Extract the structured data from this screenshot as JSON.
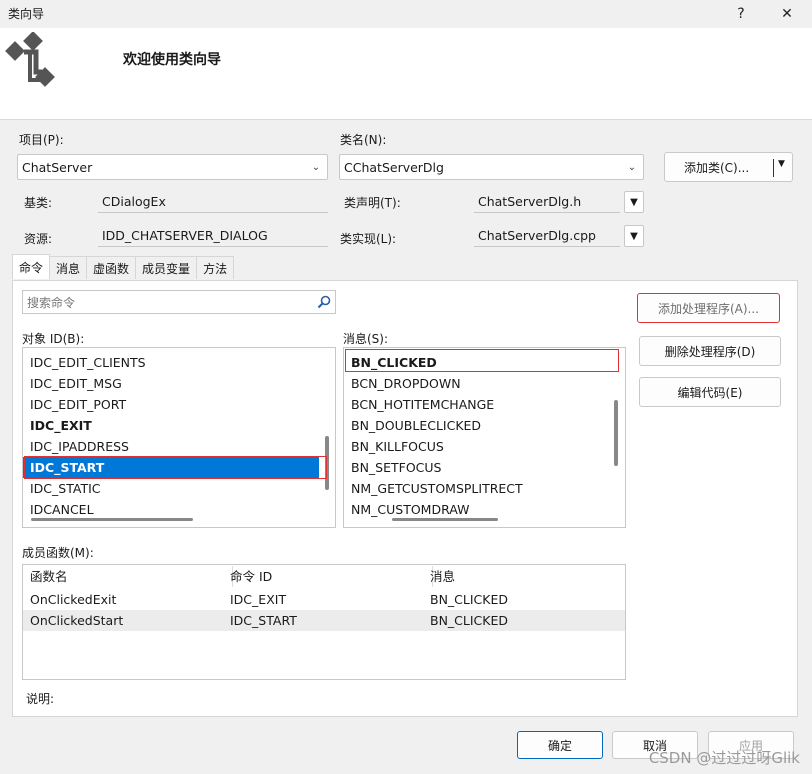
{
  "window": {
    "title": "类向导",
    "help_glyph": "?",
    "close_glyph": "✕"
  },
  "header": {
    "title": "欢迎使用类向导",
    "logo_icon": "class-wizard-logo-icon"
  },
  "project": {
    "label": "项目(P):",
    "value": "ChatServer"
  },
  "classname": {
    "label": "类名(N):",
    "value": "CChatServerDlg"
  },
  "add_class_button": "添加类(C)...",
  "base_class": {
    "label": "基类:",
    "value": "CDialogEx"
  },
  "resource": {
    "label": "资源:",
    "value": "IDD_CHATSERVER_DIALOG"
  },
  "class_decl": {
    "label": "类声明(T):",
    "value": "ChatServerDlg.h"
  },
  "class_impl": {
    "label": "类实现(L):",
    "value": "ChatServerDlg.cpp"
  },
  "tabs": [
    "命令",
    "消息",
    "虚函数",
    "成员变量",
    "方法"
  ],
  "search": {
    "placeholder": "搜索命令",
    "icon": "search-icon"
  },
  "objects": {
    "label": "对象 ID(B):",
    "items": [
      "IDC_EDIT_CLIENTS",
      "IDC_EDIT_MSG",
      "IDC_EDIT_PORT",
      "IDC_EXIT",
      "IDC_IPADDRESS",
      "IDC_START",
      "IDC_STATIC",
      "IDCANCEL"
    ],
    "selected": "IDC_START"
  },
  "messages": {
    "label": "消息(S):",
    "items": [
      "BN_CLICKED",
      "BCN_DROPDOWN",
      "BCN_HOTITEMCHANGE",
      "BN_DOUBLECLICKED",
      "BN_KILLFOCUS",
      "BN_SETFOCUS",
      "NM_GETCUSTOMSPLITRECT",
      "NM_CUSTOMDRAW"
    ]
  },
  "actions": {
    "add_handler": "添加处理程序(A)...",
    "delete_handler": "删除处理程序(D)",
    "edit_code": "编辑代码(E)"
  },
  "members": {
    "label": "成员函数(M):",
    "columns": [
      "函数名",
      "命令 ID",
      "消息"
    ],
    "rows": [
      [
        "OnClickedExit",
        "IDC_EXIT",
        "BN_CLICKED"
      ],
      [
        "OnClickedStart",
        "IDC_START",
        "BN_CLICKED"
      ]
    ]
  },
  "description": {
    "label": "说明:"
  },
  "footer": {
    "ok": "确定",
    "cancel": "取消",
    "apply": "应用"
  },
  "watermark": "CSDN @过过过呀Glik",
  "colors": {
    "selection": "#0078d7",
    "highlight_box": "#e03030",
    "ok_border": "#0067c0"
  }
}
